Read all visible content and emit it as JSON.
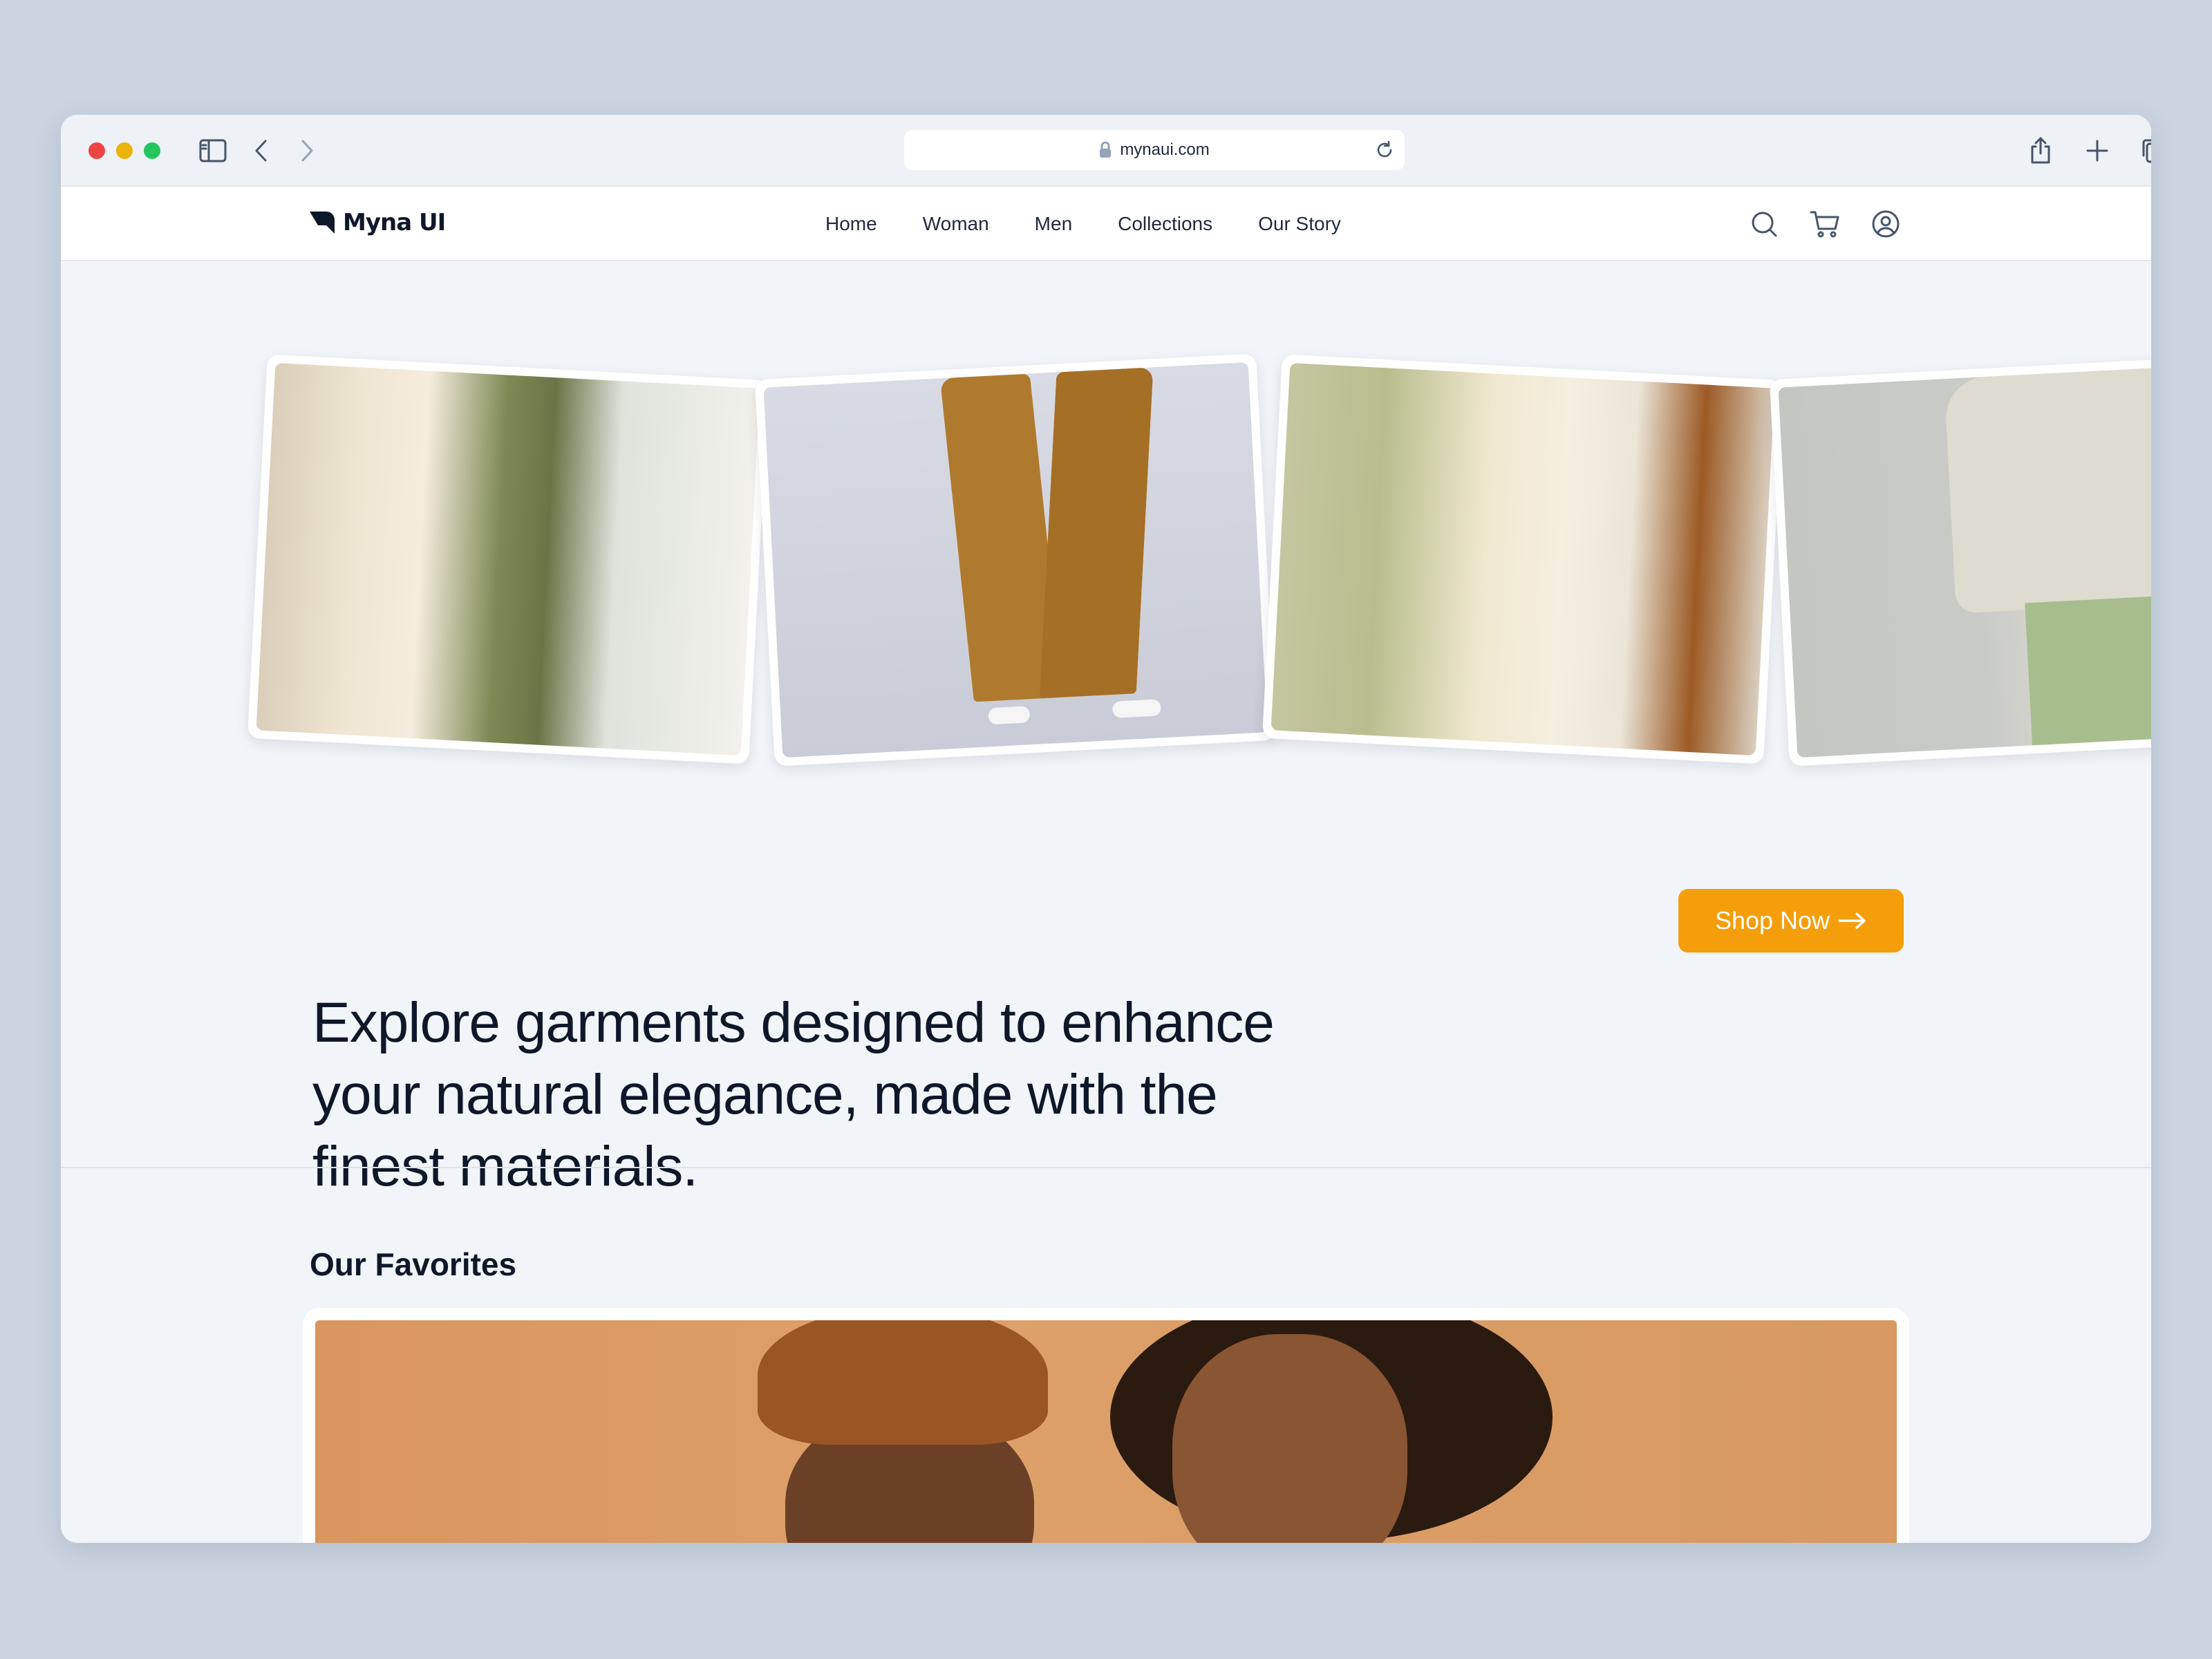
{
  "browser": {
    "url": "mynaui.com"
  },
  "site": {
    "logo_text": "Myna UI",
    "nav": [
      {
        "label": "Home"
      },
      {
        "label": "Woman"
      },
      {
        "label": "Men"
      },
      {
        "label": "Collections"
      },
      {
        "label": "Our Story"
      }
    ],
    "icons": [
      "search-icon",
      "cart-icon",
      "user-icon"
    ]
  },
  "hero": {
    "headline": "Explore garments designed to enhance your natural elegance, made with the finest materials.",
    "cta_label": "Shop Now",
    "cta_color": "#f59e0b"
  },
  "favorites": {
    "title": "Our Favorites"
  }
}
